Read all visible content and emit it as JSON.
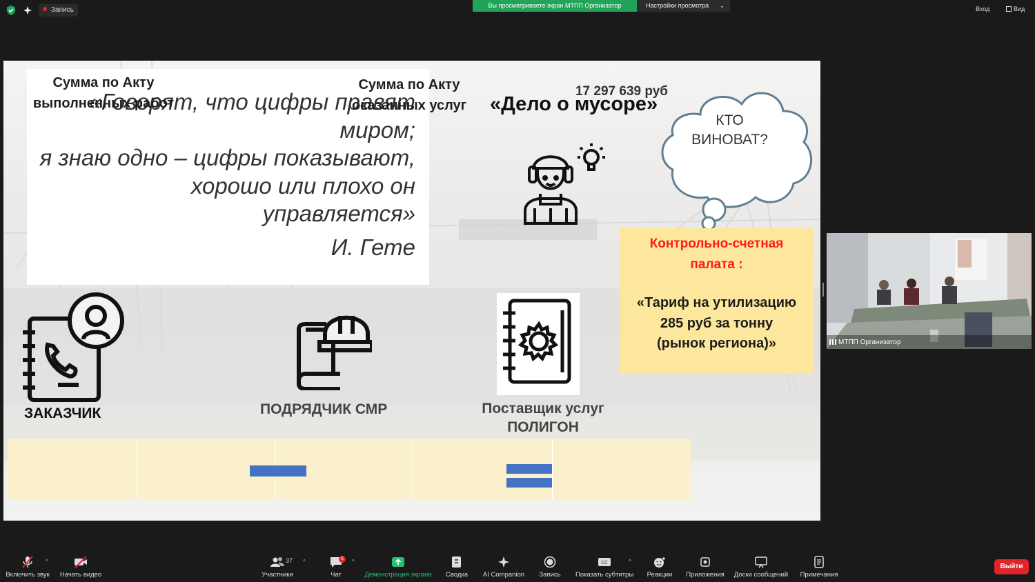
{
  "topbar": {
    "recording_label": "Запись",
    "share_banner": "Вы просматриваете экран МТПП Организатор",
    "view_settings": "Настройки просмотра",
    "exit_fullscreen": "Вход",
    "view_label": "Вид"
  },
  "slide": {
    "quote_lines": [
      "«Говорят, что цифры правят",
      "миром;",
      "я знаю одно – цифры показывают,",
      "хорошо или плохо он",
      "управляется»"
    ],
    "quote_author": "И. Гете",
    "case_title": "«Дело о мусоре»",
    "cloud_lines": [
      "КТО",
      "ВИНОВАТ?"
    ],
    "kcp_title_lines": [
      "Контрольно-счетная",
      "палата :"
    ],
    "kcp_body_lines": [
      "«Тариф на утилизацию",
      "285 руб за тонну",
      "(рынок региона)»"
    ],
    "customer_label": "ЗАКАЗЧИК",
    "contractor_label": "ПОДРЯДЧИК СМР",
    "supplier_lines": [
      "Поставщик услуг",
      "ПОЛИГОН"
    ],
    "sum1_lines": [
      "Сумма по Акту",
      "выполненных работ"
    ],
    "sum2_lines": [
      "Сумма по Акту",
      "оказанных услуг"
    ],
    "total": "17 297 639 руб"
  },
  "webcam": {
    "name": "МТПП Организатор"
  },
  "toolbar": {
    "unmute": "Включить звук",
    "start_video": "Начать видео",
    "participants": "Участники",
    "participants_count": "37",
    "chat": "Чат",
    "chat_badge": "5",
    "share_screen": "Демонстрация экрана",
    "summary": "Сводка",
    "ai_companion": "AI Companion",
    "record": "Запись",
    "captions": "Показать субтитры",
    "reactions": "Реакции",
    "apps": "Приложения",
    "whiteboards": "Доски сообщений",
    "notes": "Примечания",
    "leave": "Выйти"
  }
}
